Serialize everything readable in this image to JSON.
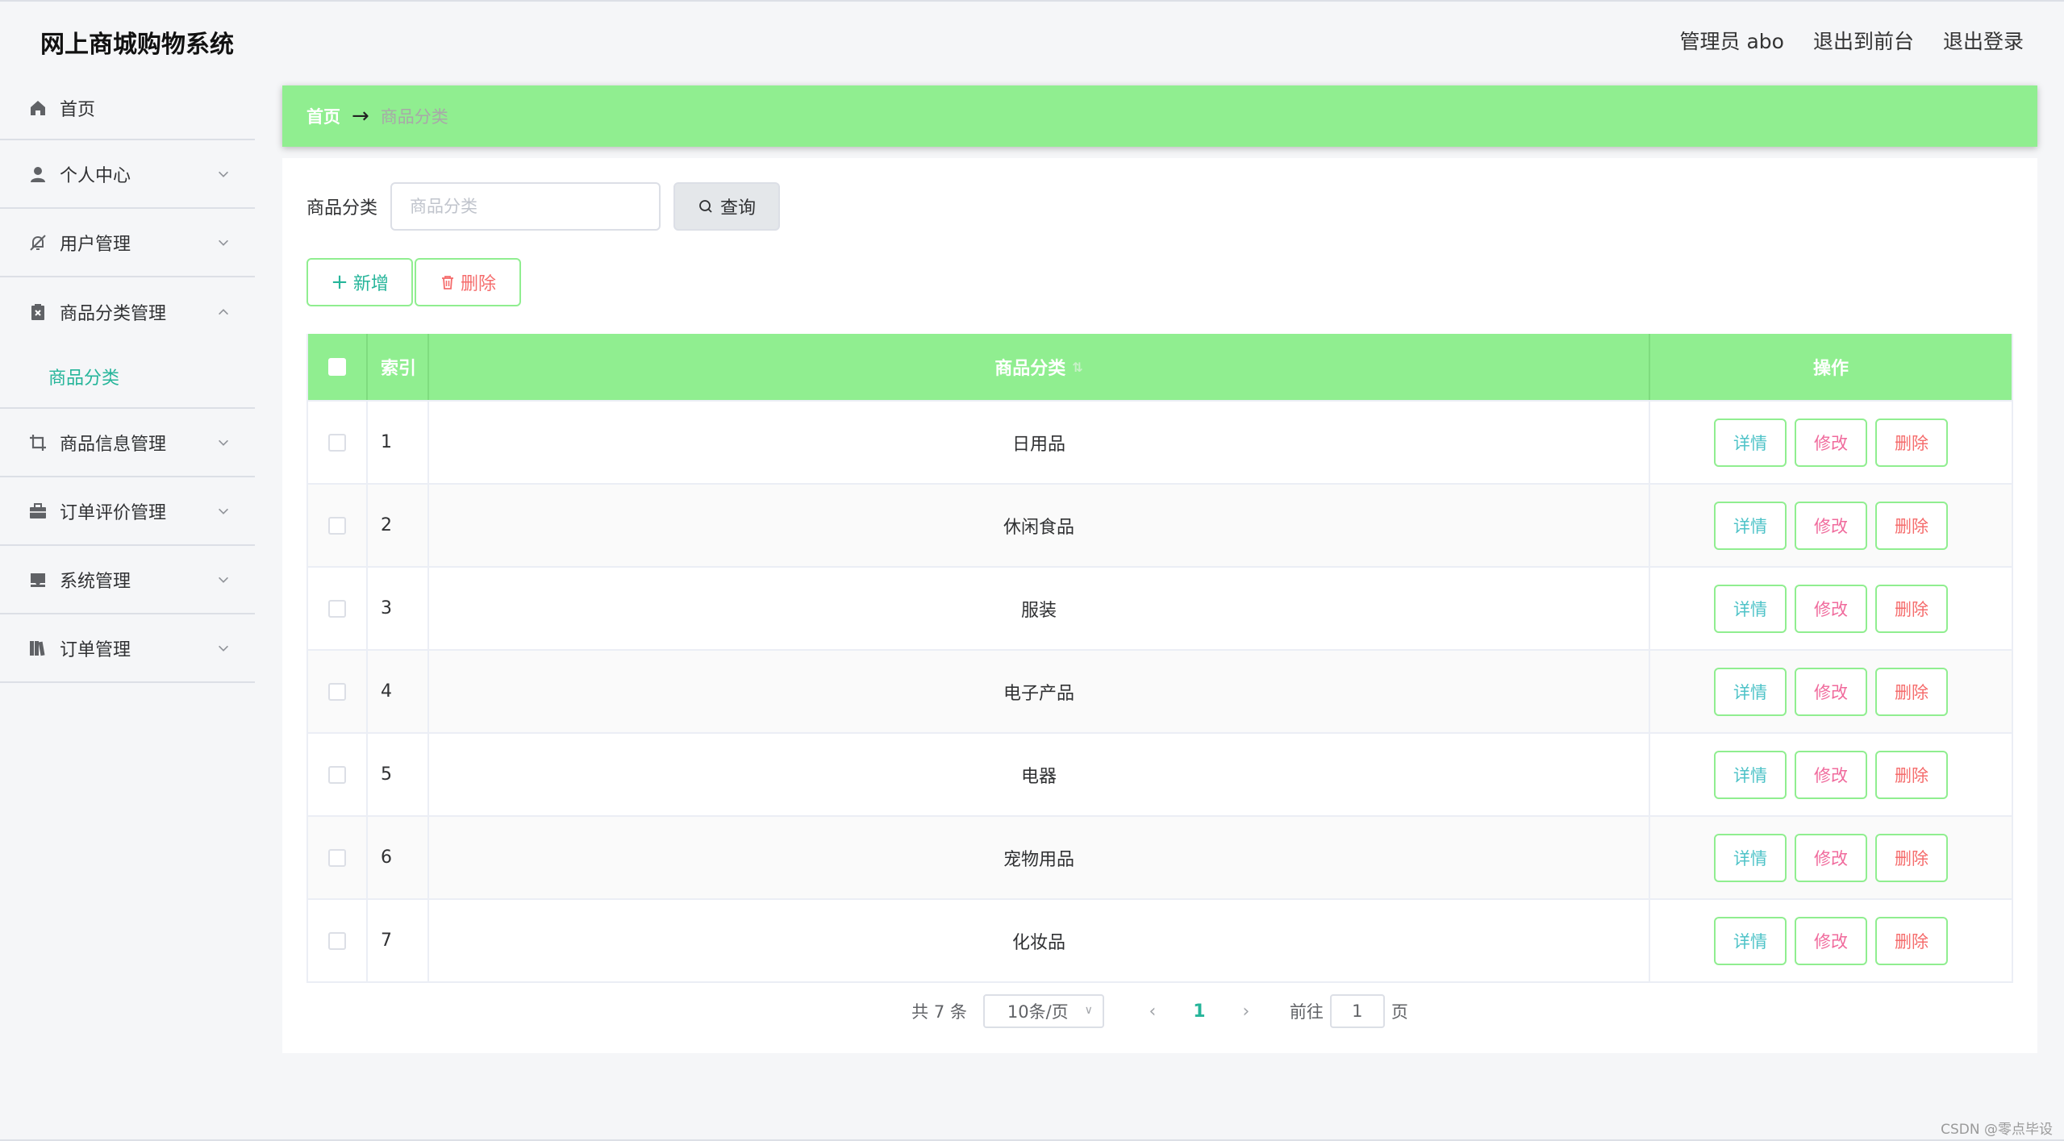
{
  "header": {
    "title": "网上商城购物系统",
    "user": "管理员 abo",
    "to_front": "退出到前台",
    "logout": "退出登录"
  },
  "sidebar": {
    "items": [
      {
        "label": "首页",
        "icon": "home-icon"
      },
      {
        "label": "个人中心",
        "icon": "user-icon"
      },
      {
        "label": "用户管理",
        "icon": "bell-off-icon"
      },
      {
        "label": "商品分类管理",
        "icon": "clipboard-x-icon",
        "expanded": true
      },
      {
        "label": "商品信息管理",
        "icon": "crop-icon"
      },
      {
        "label": "订单评价管理",
        "icon": "briefcase-icon"
      },
      {
        "label": "系统管理",
        "icon": "tray-icon"
      },
      {
        "label": "订单管理",
        "icon": "books-icon"
      }
    ],
    "sub_item": "商品分类"
  },
  "breadcrumb": {
    "home": "首页",
    "arrow": "→",
    "current": "商品分类"
  },
  "search": {
    "label": "商品分类",
    "placeholder": "商品分类",
    "button": "查询"
  },
  "actions": {
    "add": "新增",
    "delete": "删除"
  },
  "table": {
    "headers": {
      "index": "索引",
      "name": "商品分类",
      "op": "操作"
    },
    "rows": [
      {
        "index": "1",
        "name": "日用品"
      },
      {
        "index": "2",
        "name": "休闲食品"
      },
      {
        "index": "3",
        "name": "服装"
      },
      {
        "index": "4",
        "name": "电子产品"
      },
      {
        "index": "5",
        "name": "电器"
      },
      {
        "index": "6",
        "name": "宠物用品"
      },
      {
        "index": "7",
        "name": "化妆品"
      }
    ],
    "row_actions": {
      "detail": "详情",
      "edit": "修改",
      "remove": "删除"
    }
  },
  "pagination": {
    "total": "共 7 条",
    "page_size": "10条/页",
    "current": "1",
    "goto_label": "前往",
    "goto_value": "1",
    "page_suffix": "页"
  },
  "watermark": "CSDN @零点毕设",
  "colors": {
    "accent_green": "#90ee90",
    "teal_text": "#26b59a",
    "danger": "#f56c6c",
    "edit_pink": "#f06a9c"
  }
}
